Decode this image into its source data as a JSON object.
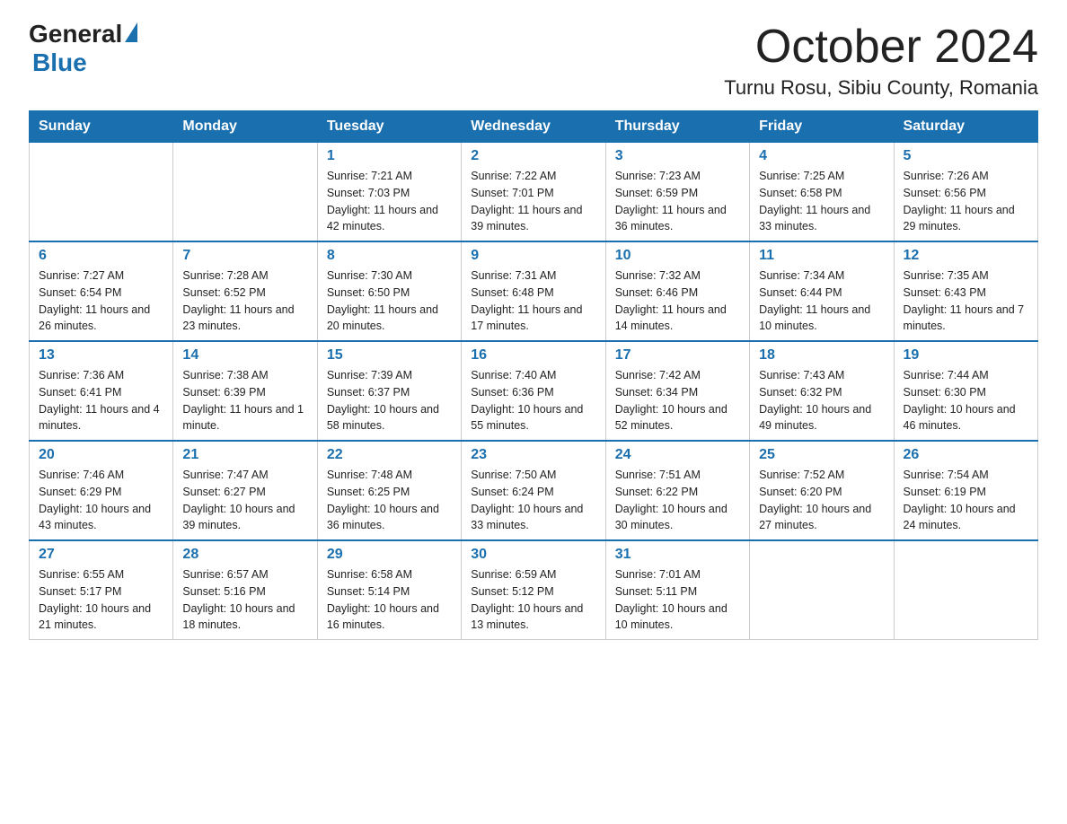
{
  "header": {
    "logo_general": "General",
    "logo_blue": "Blue",
    "month_title": "October 2024",
    "location": "Turnu Rosu, Sibiu County, Romania"
  },
  "weekdays": [
    "Sunday",
    "Monday",
    "Tuesday",
    "Wednesday",
    "Thursday",
    "Friday",
    "Saturday"
  ],
  "weeks": [
    [
      {
        "day": null
      },
      {
        "day": null
      },
      {
        "day": "1",
        "sunrise": "7:21 AM",
        "sunset": "7:03 PM",
        "daylight": "11 hours and 42 minutes."
      },
      {
        "day": "2",
        "sunrise": "7:22 AM",
        "sunset": "7:01 PM",
        "daylight": "11 hours and 39 minutes."
      },
      {
        "day": "3",
        "sunrise": "7:23 AM",
        "sunset": "6:59 PM",
        "daylight": "11 hours and 36 minutes."
      },
      {
        "day": "4",
        "sunrise": "7:25 AM",
        "sunset": "6:58 PM",
        "daylight": "11 hours and 33 minutes."
      },
      {
        "day": "5",
        "sunrise": "7:26 AM",
        "sunset": "6:56 PM",
        "daylight": "11 hours and 29 minutes."
      }
    ],
    [
      {
        "day": "6",
        "sunrise": "7:27 AM",
        "sunset": "6:54 PM",
        "daylight": "11 hours and 26 minutes."
      },
      {
        "day": "7",
        "sunrise": "7:28 AM",
        "sunset": "6:52 PM",
        "daylight": "11 hours and 23 minutes."
      },
      {
        "day": "8",
        "sunrise": "7:30 AM",
        "sunset": "6:50 PM",
        "daylight": "11 hours and 20 minutes."
      },
      {
        "day": "9",
        "sunrise": "7:31 AM",
        "sunset": "6:48 PM",
        "daylight": "11 hours and 17 minutes."
      },
      {
        "day": "10",
        "sunrise": "7:32 AM",
        "sunset": "6:46 PM",
        "daylight": "11 hours and 14 minutes."
      },
      {
        "day": "11",
        "sunrise": "7:34 AM",
        "sunset": "6:44 PM",
        "daylight": "11 hours and 10 minutes."
      },
      {
        "day": "12",
        "sunrise": "7:35 AM",
        "sunset": "6:43 PM",
        "daylight": "11 hours and 7 minutes."
      }
    ],
    [
      {
        "day": "13",
        "sunrise": "7:36 AM",
        "sunset": "6:41 PM",
        "daylight": "11 hours and 4 minutes."
      },
      {
        "day": "14",
        "sunrise": "7:38 AM",
        "sunset": "6:39 PM",
        "daylight": "11 hours and 1 minute."
      },
      {
        "day": "15",
        "sunrise": "7:39 AM",
        "sunset": "6:37 PM",
        "daylight": "10 hours and 58 minutes."
      },
      {
        "day": "16",
        "sunrise": "7:40 AM",
        "sunset": "6:36 PM",
        "daylight": "10 hours and 55 minutes."
      },
      {
        "day": "17",
        "sunrise": "7:42 AM",
        "sunset": "6:34 PM",
        "daylight": "10 hours and 52 minutes."
      },
      {
        "day": "18",
        "sunrise": "7:43 AM",
        "sunset": "6:32 PM",
        "daylight": "10 hours and 49 minutes."
      },
      {
        "day": "19",
        "sunrise": "7:44 AM",
        "sunset": "6:30 PM",
        "daylight": "10 hours and 46 minutes."
      }
    ],
    [
      {
        "day": "20",
        "sunrise": "7:46 AM",
        "sunset": "6:29 PM",
        "daylight": "10 hours and 43 minutes."
      },
      {
        "day": "21",
        "sunrise": "7:47 AM",
        "sunset": "6:27 PM",
        "daylight": "10 hours and 39 minutes."
      },
      {
        "day": "22",
        "sunrise": "7:48 AM",
        "sunset": "6:25 PM",
        "daylight": "10 hours and 36 minutes."
      },
      {
        "day": "23",
        "sunrise": "7:50 AM",
        "sunset": "6:24 PM",
        "daylight": "10 hours and 33 minutes."
      },
      {
        "day": "24",
        "sunrise": "7:51 AM",
        "sunset": "6:22 PM",
        "daylight": "10 hours and 30 minutes."
      },
      {
        "day": "25",
        "sunrise": "7:52 AM",
        "sunset": "6:20 PM",
        "daylight": "10 hours and 27 minutes."
      },
      {
        "day": "26",
        "sunrise": "7:54 AM",
        "sunset": "6:19 PM",
        "daylight": "10 hours and 24 minutes."
      }
    ],
    [
      {
        "day": "27",
        "sunrise": "6:55 AM",
        "sunset": "5:17 PM",
        "daylight": "10 hours and 21 minutes."
      },
      {
        "day": "28",
        "sunrise": "6:57 AM",
        "sunset": "5:16 PM",
        "daylight": "10 hours and 18 minutes."
      },
      {
        "day": "29",
        "sunrise": "6:58 AM",
        "sunset": "5:14 PM",
        "daylight": "10 hours and 16 minutes."
      },
      {
        "day": "30",
        "sunrise": "6:59 AM",
        "sunset": "5:12 PM",
        "daylight": "10 hours and 13 minutes."
      },
      {
        "day": "31",
        "sunrise": "7:01 AM",
        "sunset": "5:11 PM",
        "daylight": "10 hours and 10 minutes."
      },
      {
        "day": null
      },
      {
        "day": null
      }
    ]
  ]
}
